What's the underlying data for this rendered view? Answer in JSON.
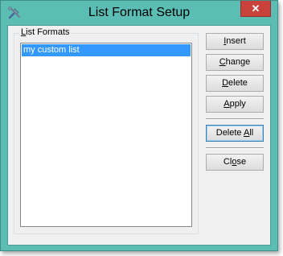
{
  "window": {
    "title": "List Format Setup",
    "close_label": "✕"
  },
  "group": {
    "label": "List Formats"
  },
  "list": {
    "items": [
      "my custom list"
    ]
  },
  "buttons": {
    "insert": "Insert",
    "change": "Change",
    "delete": "Delete",
    "apply": "Apply",
    "delete_all": "Delete All",
    "close": "Close"
  },
  "colors": {
    "frame": "#5cbdb4",
    "close_button": "#c8413a",
    "selection": "#3399ff",
    "dialog_background": "#f0f0f0"
  },
  "icons": {
    "app": "tools-icon"
  }
}
